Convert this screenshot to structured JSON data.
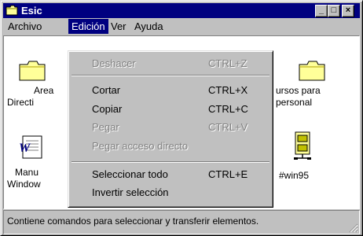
{
  "window": {
    "title": "Esic",
    "controls": {
      "minimize": "_",
      "maximize": "□",
      "close": "×"
    }
  },
  "menubar": {
    "items": [
      {
        "label": "Archivo",
        "accel": "A",
        "active": false
      },
      {
        "label": "Edición",
        "accel": "E",
        "active": true
      },
      {
        "label": "Ver",
        "accel": "V",
        "active": false
      },
      {
        "label": "Ayuda",
        "accel": "y",
        "active": false
      }
    ]
  },
  "content": {
    "icons": [
      {
        "type": "folder",
        "label_lines": [
          "Area",
          "Directi"
        ]
      },
      {
        "type": "folder",
        "label_lines": [
          "ursos para",
          "personal"
        ]
      },
      {
        "type": "document",
        "label_lines": [
          "Manu",
          "Window"
        ]
      },
      {
        "type": "cabinet",
        "label_lines": [
          "#win95"
        ]
      }
    ]
  },
  "edit_menu": {
    "items": [
      {
        "label": "Deshacer",
        "shortcut": "CTRL+Z",
        "enabled": false
      },
      {
        "separator": true
      },
      {
        "label": "Cortar",
        "shortcut": "CTRL+X",
        "enabled": true
      },
      {
        "label": "Copiar",
        "shortcut": "CTRL+C",
        "enabled": true
      },
      {
        "label": "Pegar",
        "shortcut": "CTRL+V",
        "enabled": false
      },
      {
        "label": "Pegar acceso directo",
        "shortcut": "",
        "enabled": false
      },
      {
        "separator": true
      },
      {
        "label": "Seleccionar todo",
        "shortcut": "CTRL+E",
        "enabled": true
      },
      {
        "label": "Invertir selección",
        "shortcut": "",
        "enabled": true
      }
    ]
  },
  "statusbar": {
    "text": "Contiene comandos para seleccionar y transferir elementos."
  },
  "colors": {
    "titlebar": "#000080",
    "face": "#c0c0c0",
    "highlight": "#000080",
    "folder": "#ffff99"
  }
}
